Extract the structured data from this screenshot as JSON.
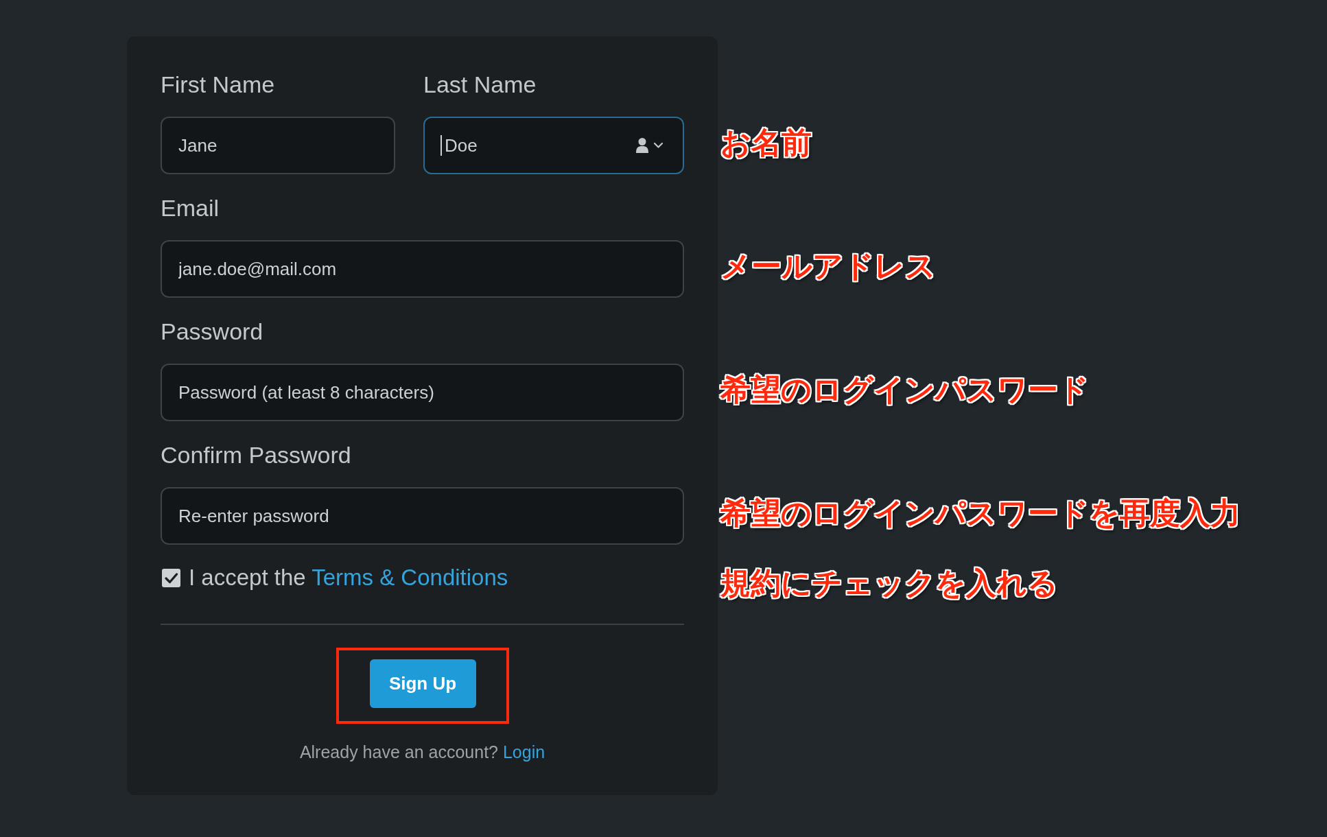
{
  "name_row": {
    "note": "お名前",
    "fields": [
      {
        "label": "First Name",
        "value": "Jane",
        "focused": false
      },
      {
        "label": "Last Name",
        "value": "Doe",
        "focused": true
      }
    ]
  },
  "fields": [
    {
      "label": "Email",
      "value": "jane.doe@mail.com",
      "focused": false,
      "note": "メールアドレス"
    },
    {
      "label": "Password",
      "placeholder": "Password (at least 8 characters)",
      "focused": false,
      "note": "希望のログインパスワード"
    },
    {
      "label": "Confirm Password",
      "placeholder": "Re-enter password",
      "focused": false,
      "note": "希望のログインパスワードを再度入力"
    }
  ],
  "terms": {
    "checked": true,
    "text": "I accept the",
    "link": "Terms & Conditions",
    "note": "規約にチェックを入れる"
  },
  "submit": {
    "label": "Sign Up",
    "highlighted": true
  },
  "footer": {
    "text": "Already have an account?",
    "link": "Login"
  }
}
